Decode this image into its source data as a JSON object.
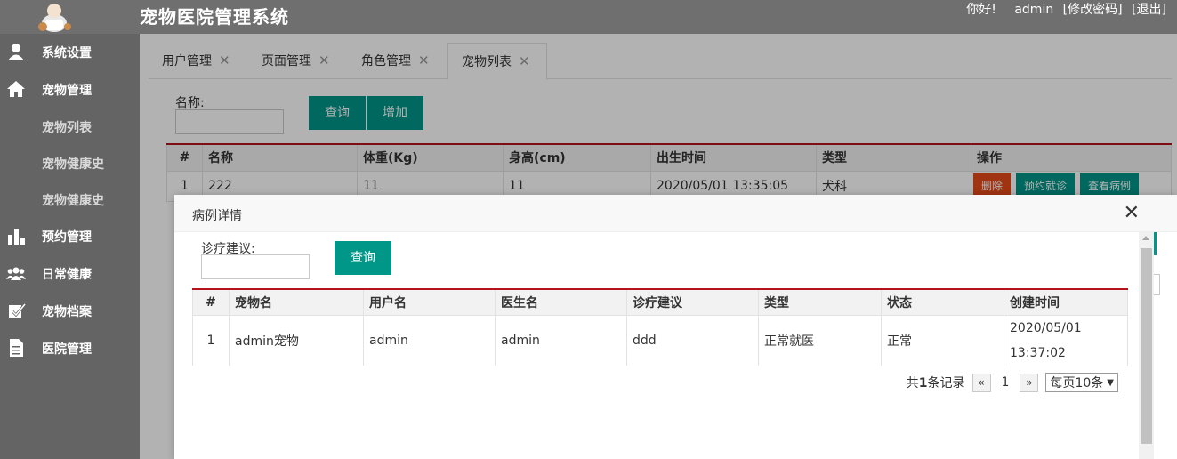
{
  "header": {
    "title": "宠物医院管理系统",
    "greeting": "你好!",
    "username": "admin",
    "change_password": "[修改密码]",
    "logout": "[退出]"
  },
  "sidebar": {
    "items": [
      {
        "label": "系统设置",
        "icon": "user-icon"
      },
      {
        "label": "宠物管理",
        "icon": "home-icon"
      },
      {
        "label": "预约管理",
        "icon": "bar-chart-icon"
      },
      {
        "label": "日常健康",
        "icon": "group-icon"
      },
      {
        "label": "宠物档案",
        "icon": "check-doc-icon"
      },
      {
        "label": "医院管理",
        "icon": "document-icon"
      }
    ],
    "sub_items": [
      "宠物列表",
      "宠物健康史",
      "宠物健康史"
    ]
  },
  "tabs": [
    {
      "label": "用户管理",
      "close": "✕"
    },
    {
      "label": "页面管理",
      "close": "✕"
    },
    {
      "label": "角色管理",
      "close": "✕"
    },
    {
      "label": "宠物列表",
      "close": "✕"
    }
  ],
  "pet_list": {
    "search_label": "名称:",
    "search_value": "",
    "query_button": "查询",
    "add_button": "增加",
    "columns": [
      "#",
      "名称",
      "体重(Kg)",
      "身高(cm)",
      "出生时间",
      "类型",
      "操作"
    ],
    "rows": [
      {
        "idx": "1",
        "name": "222",
        "weight": "11",
        "height": "11",
        "birth": "2020/05/01 13:35:05",
        "type": "犬科"
      }
    ],
    "row_actions": [
      "删除",
      "预约就诊",
      "查看病例"
    ]
  },
  "modal": {
    "title": "病例详情",
    "close_glyph": "✕",
    "search_label": "诊疗建议:",
    "search_value": "",
    "query_button": "查询",
    "columns": [
      "#",
      "宠物名",
      "用户名",
      "医生名",
      "诊疗建议",
      "类型",
      "状态",
      "创建时间"
    ],
    "rows": [
      {
        "idx": "1",
        "pet": "admin宠物",
        "user": "admin",
        "doctor": "admin",
        "advice": "ddd",
        "type": "正常就医",
        "status": "正常",
        "created_date": "2020/05/01",
        "created_time": "13:37:02"
      }
    ],
    "pager": {
      "total_prefix": "共",
      "total": "1",
      "total_suffix": "条记录",
      "prev": "«",
      "current": "1",
      "next": "»",
      "page_size": "每页10条"
    }
  },
  "colors": {
    "teal": "#009688",
    "red_accent": "#b5121b",
    "delete_red": "#e64a19",
    "header_bg": "#6f6f6f",
    "sidebar_bg": "#646464"
  }
}
